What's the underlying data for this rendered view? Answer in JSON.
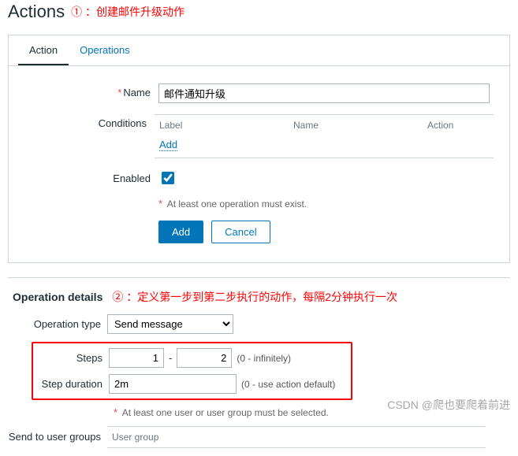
{
  "header": {
    "title": "Actions",
    "annot1": "① ：创建邮件升级动作"
  },
  "tabs": {
    "action": "Action",
    "operations": "Operations"
  },
  "form": {
    "name_label": "Name",
    "name_value": "邮件通知升级",
    "conditions_label": "Conditions",
    "cond_cols": {
      "label": "Label",
      "name": "Name",
      "action": "Action"
    },
    "cond_add": "Add",
    "enabled_label": "Enabled",
    "enabled_checked": true,
    "must_exist_hint": "At least one operation must exist.",
    "btn_add": "Add",
    "btn_cancel": "Cancel"
  },
  "op": {
    "section_title": "Operation details",
    "annot2": "② ：定义第一步到第二步执行的动作，每隔2分钟执行一次",
    "type_label": "Operation type",
    "type_value": "Send message",
    "steps_label": "Steps",
    "steps_from": "1",
    "steps_to": "2",
    "steps_hint": "(0 - infinitely)",
    "duration_label": "Step duration",
    "duration_value": "2m",
    "duration_hint": "(0 - use action default)",
    "user_hint": "At least one user or user group must be selected.",
    "send_ug_label": "Send to user groups",
    "ug_col": "User group"
  },
  "watermark": "CSDN @爬也要爬着前进"
}
